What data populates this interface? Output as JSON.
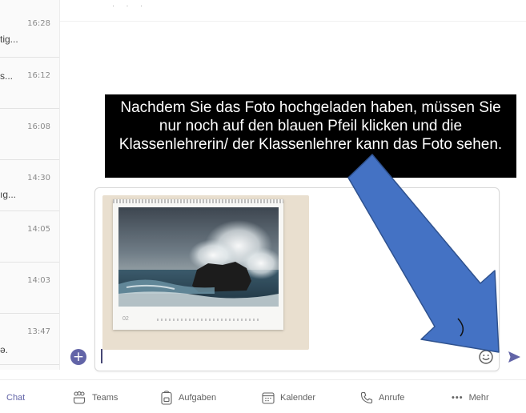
{
  "chat_list": [
    {
      "time": "16:28",
      "snippet": "tig..."
    },
    {
      "time": "16:12",
      "snippet": "s..."
    },
    {
      "time": "16:08",
      "snippet": ""
    },
    {
      "time": "14:30",
      "snippet": "ıg..."
    },
    {
      "time": "14:05",
      "snippet": ""
    },
    {
      "time": "14:03",
      "snippet": ""
    },
    {
      "time": "13:47",
      "snippet": "ə."
    }
  ],
  "annotation": {
    "text": "Nachdem Sie das Foto hochgeladen haben, müssen Sie nur noch auf den blauen Pfeil klicken und die Klassenlehrerin/ der Klassenlehrer kann das Foto sehen."
  },
  "photo": {
    "month_label": "02"
  },
  "colors": {
    "accent": "#6264a7",
    "annotation_arrow": "#4472c4",
    "annotation_bg": "#000000"
  },
  "bottom_nav": {
    "chat": "Chat",
    "teams": "Teams",
    "aufgaben": "Aufgaben",
    "kalender": "Kalender",
    "anrufe": "Anrufe",
    "mehr": "Mehr"
  }
}
